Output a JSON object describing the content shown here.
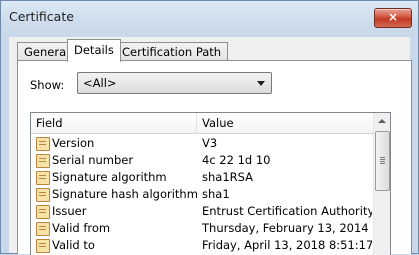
{
  "window": {
    "title": "Certificate",
    "close_glyph": "×",
    "close_icon": "close-icon"
  },
  "tabs": [
    {
      "label": "General",
      "active": false
    },
    {
      "label": "Details",
      "active": true
    },
    {
      "label": "Certification Path",
      "active": false
    }
  ],
  "details": {
    "show_label": "Show:",
    "show_value": "<All>",
    "dropdown_icon": "chevron-down-icon",
    "columns": {
      "field": "Field",
      "value": "Value"
    },
    "row_icon": "certificate-field-icon",
    "rows": [
      {
        "field": "Version",
        "value": "V3"
      },
      {
        "field": "Serial number",
        "value": "4c 22 1d 10"
      },
      {
        "field": "Signature algorithm",
        "value": "sha1RSA"
      },
      {
        "field": "Signature hash algorithm",
        "value": "sha1"
      },
      {
        "field": "Issuer",
        "value": "Entrust Certification Authority ..."
      },
      {
        "field": "Valid from",
        "value": "Thursday, February 13, 2014 ..."
      },
      {
        "field": "Valid to",
        "value": "Friday, April 13, 2018 8:51:17..."
      }
    ]
  },
  "colors": {
    "titlebar": "#c9d9ea",
    "close_button": "#c13a24",
    "panel_background": "#ffffff"
  }
}
